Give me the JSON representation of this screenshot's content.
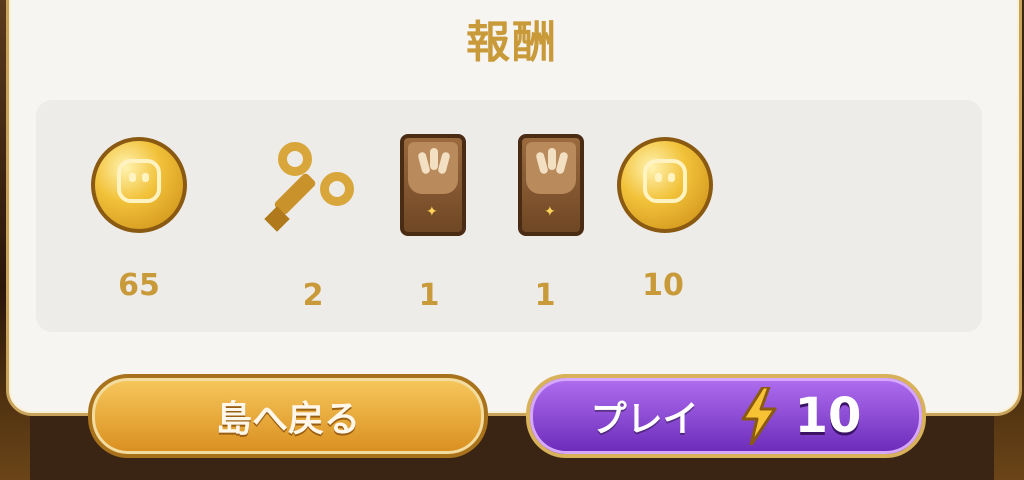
{
  "title": "報酬",
  "rewards": [
    {
      "icon": "coin-icon",
      "count": "65"
    },
    {
      "icon": "windup-key-icon",
      "count": "2"
    },
    {
      "icon": "card-pack-icon",
      "count": "1"
    },
    {
      "icon": "card-pack-icon",
      "count": "1"
    },
    {
      "icon": "coin-icon",
      "count": "10"
    }
  ],
  "buttons": {
    "back_label": "島へ戻る",
    "play_label": "プレイ",
    "play_energy_cost": "10",
    "energy_icon": "lightning-bolt-icon"
  },
  "colors": {
    "accent_gold": "#c99a3a",
    "play_purple": "#8a45d8",
    "back_orange": "#e8a63a"
  }
}
